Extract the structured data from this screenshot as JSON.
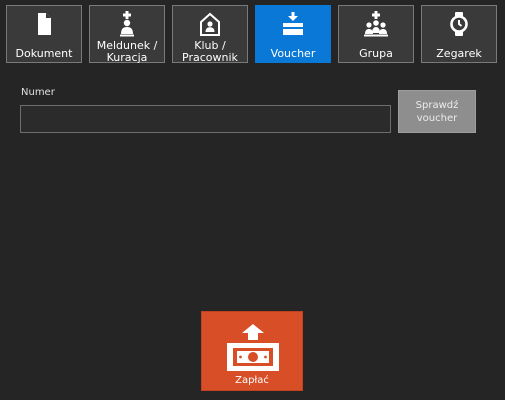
{
  "tabs": [
    {
      "label_line1": "Dokument",
      "label_line2": "",
      "icon": "document-icon",
      "active": false
    },
    {
      "label_line1": "Meldunek /",
      "label_line2": "Kuracja",
      "icon": "person-check-in-icon",
      "active": false
    },
    {
      "label_line1": "Klub /",
      "label_line2": "Pracownik",
      "icon": "house-person-icon",
      "active": false
    },
    {
      "label_line1": "Voucher",
      "label_line2": "",
      "icon": "voucher-icon",
      "active": true
    },
    {
      "label_line1": "Grupa",
      "label_line2": "",
      "icon": "group-icon",
      "active": false
    },
    {
      "label_line1": "Zegarek",
      "label_line2": "",
      "icon": "watch-icon",
      "active": false
    }
  ],
  "form": {
    "numer_label": "Numer",
    "numer_value": "",
    "check_button_line1": "Sprawdź",
    "check_button_line2": "voucher"
  },
  "pay": {
    "label": "Zapłać",
    "icon": "pay-money-icon"
  },
  "colors": {
    "background": "#252525",
    "tab": "#3a3a3a",
    "tab_active": "#0a78d7",
    "pay": "#d84e26",
    "check_button": "#8e8e8e"
  }
}
